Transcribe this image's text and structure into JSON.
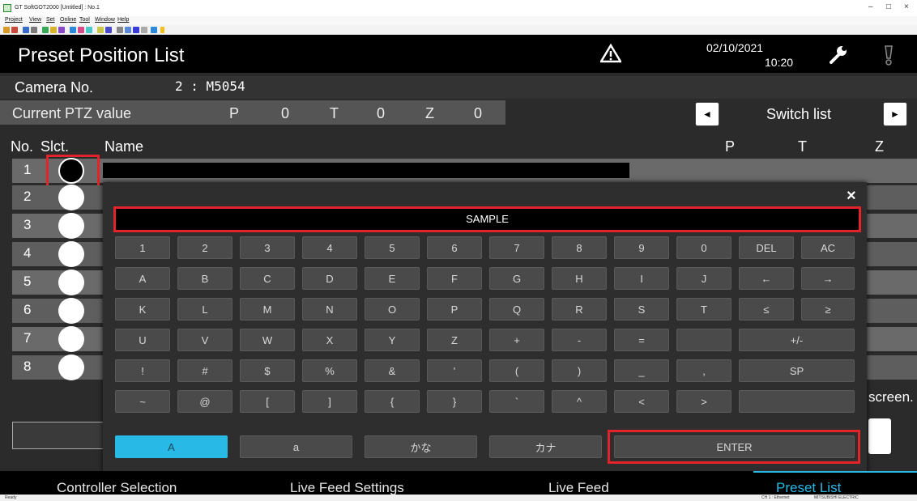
{
  "window": {
    "title": "GT SoftGOT2000 [Untitled] : No.1",
    "controls": [
      "–",
      "□",
      "×"
    ]
  },
  "menu": [
    "Project",
    "View",
    "Set",
    "Online",
    "Tool",
    "Window",
    "Help"
  ],
  "header": {
    "title": "Preset Position List",
    "date": "02/10/2021",
    "time": "10:20",
    "warning_icon": "warning-triangle-icon",
    "tool_icon": "wrench-icon",
    "alarm_icon": "exclamation-icon"
  },
  "camera": {
    "label": "Camera No.",
    "value": "2 : M5054"
  },
  "ptz": {
    "label": "Current PTZ value",
    "p_label": "P",
    "p_value": "0",
    "t_label": "T",
    "t_value": "0",
    "z_label": "Z",
    "z_value": "0"
  },
  "switch_list": {
    "label": "Switch list",
    "prev": "◄",
    "next": "►"
  },
  "columns": {
    "no": "No.",
    "slct": "Slct.",
    "name": "Name",
    "p": "P",
    "t": "T",
    "z": "Z"
  },
  "rows": [
    "1",
    "2",
    "3",
    "4",
    "5",
    "6",
    "7",
    "8"
  ],
  "partial_text": "screen.",
  "keyboard": {
    "close": "×",
    "input_value": "SAMPLE",
    "rows": [
      [
        "1",
        "2",
        "3",
        "4",
        "5",
        "6",
        "7",
        "8",
        "9",
        "0",
        "DEL",
        "AC"
      ],
      [
        "A",
        "B",
        "C",
        "D",
        "E",
        "F",
        "G",
        "H",
        "I",
        "J",
        "←",
        "→"
      ],
      [
        "K",
        "L",
        "M",
        "N",
        "O",
        "P",
        "Q",
        "R",
        "S",
        "T",
        "≤",
        "≥"
      ],
      [
        "U",
        "V",
        "W",
        "X",
        "Y",
        "Z",
        "+",
        "-",
        "=",
        "",
        "+/-"
      ],
      [
        "!",
        "#",
        "$",
        "%",
        "&",
        "'",
        "(",
        ")",
        "_",
        ",",
        "SP"
      ],
      [
        "~",
        "@",
        "[",
        "]",
        "{",
        "}",
        "`",
        "^",
        "<",
        ">",
        ""
      ]
    ],
    "modes": [
      "A",
      "a",
      "かな",
      "カナ"
    ],
    "enter": "ENTER"
  },
  "nav": [
    "Controller Selection",
    "Live Feed Settings",
    "Live Feed",
    "Preset List"
  ],
  "status": {
    "left": "Ready",
    "channel": "CH 1 : Ethernet",
    "vendor": "MITSUBISHI ELECTRIC"
  },
  "colors": {
    "accent": "#29b9e6",
    "highlight": "#e3232a",
    "active_tab": "#29b9e6"
  }
}
